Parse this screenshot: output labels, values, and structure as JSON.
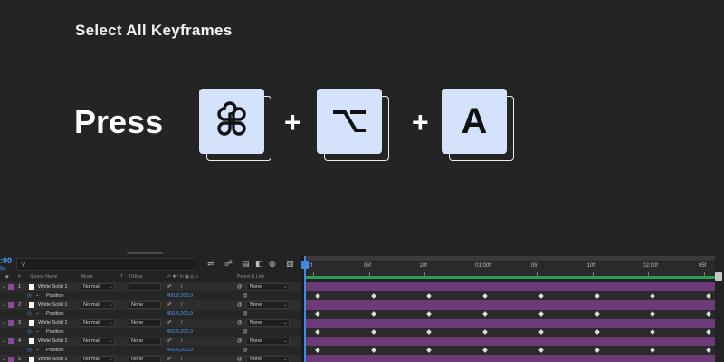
{
  "tutorial": {
    "title": "Select All Keyframes",
    "press": "Press",
    "keys": [
      {
        "icon": "command-key-icon",
        "glyph": "⌘"
      },
      {
        "icon": "option-key-icon",
        "glyph": "⌥"
      },
      {
        "icon": "a-key-icon",
        "glyph": "A"
      }
    ],
    "plus": "+",
    "key_face_color": "#d5e2fb"
  },
  "timeline": {
    "timecode": ":00",
    "timecode_sub": "fps",
    "search_placeholder": "",
    "columns": {
      "source_name": "Source Name",
      "mode": "Mode",
      "t": "T",
      "trkmat": "TrkMat",
      "parent_link": "Parent & Link"
    },
    "layers": [
      {
        "index": "1",
        "name": "White Solid 1",
        "mode": "Normal",
        "trkmat": "",
        "parent": "None",
        "prop": "Position",
        "value": "400,0,200,0"
      },
      {
        "index": "2",
        "name": "White Solid 1",
        "mode": "Normal",
        "trkmat": "None",
        "parent": "None",
        "prop": "Position",
        "value": "400,0,200,0"
      },
      {
        "index": "3",
        "name": "White Solid 1",
        "mode": "Normal",
        "trkmat": "None",
        "parent": "None",
        "prop": "Position",
        "value": "400,0,200,0"
      },
      {
        "index": "4",
        "name": "White Solid 1",
        "mode": "Normal",
        "trkmat": "None",
        "parent": "None",
        "prop": "Position",
        "value": "400,0,200,0"
      },
      {
        "index": "5",
        "name": "White Solid 1",
        "mode": "Normal",
        "trkmat": "None",
        "parent": "None",
        "prop": "",
        "value": ""
      }
    ],
    "ruler_labels": [
      "0f",
      "05f",
      "10f",
      "01:00f",
      "05f",
      "10f",
      "02:00f",
      "05f"
    ],
    "keyframe_count_per_row": 8,
    "layer_bar_color": "#6d3a78",
    "accent_color": "#3b8ce8"
  }
}
